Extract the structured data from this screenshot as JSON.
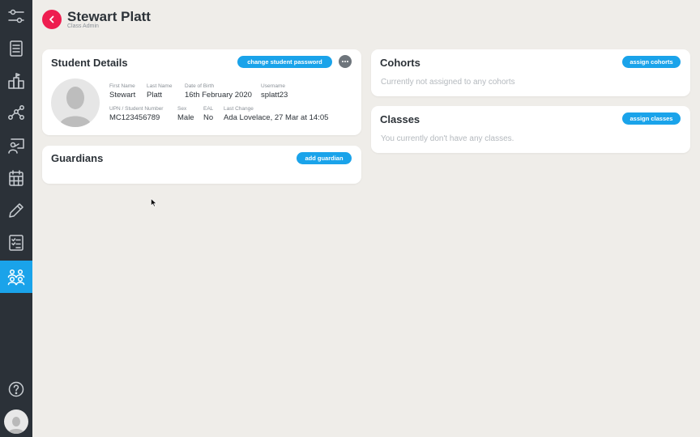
{
  "header": {
    "title": "Stewart Platt",
    "subtitle": "Class Admin"
  },
  "nav": [
    {
      "icon": "settings-sliders-icon"
    },
    {
      "icon": "list-document-icon"
    },
    {
      "icon": "school-building-icon"
    },
    {
      "icon": "network-graph-icon"
    },
    {
      "icon": "presentation-icon"
    },
    {
      "icon": "calendar-icon"
    },
    {
      "icon": "pencil-icon"
    },
    {
      "icon": "checklist-icon"
    },
    {
      "icon": "people-group-icon",
      "active": true
    },
    {
      "icon": "help-icon"
    }
  ],
  "student_details": {
    "title": "Student Details",
    "change_password_label": "change student password",
    "fields": {
      "first_name": {
        "label": "First Name",
        "value": "Stewart"
      },
      "last_name": {
        "label": "Last Name",
        "value": "Platt"
      },
      "dob": {
        "label": "Date of Birth",
        "value": "16th February 2020"
      },
      "username": {
        "label": "Username",
        "value": "splatt23"
      },
      "upn": {
        "label": "UPN / Student Number",
        "value": "MC123456789"
      },
      "sex": {
        "label": "Sex",
        "value": "Male"
      },
      "eal": {
        "label": "EAL",
        "value": "No"
      },
      "last_change": {
        "label": "Last Change",
        "value": "Ada Lovelace, 27 Mar at 14:05"
      }
    }
  },
  "guardians": {
    "title": "Guardians",
    "add_label": "add guardian"
  },
  "cohorts": {
    "title": "Cohorts",
    "assign_label": "assign cohorts",
    "empty_text": "Currently not assigned to any cohorts"
  },
  "classes": {
    "title": "Classes",
    "assign_label": "assign classes",
    "empty_text": "You currently don't have any classes."
  },
  "colors": {
    "accent": "#1aa3ea",
    "back_button": "#ee1d4f",
    "sidebar": "#2b3138",
    "background": "#efede9"
  }
}
